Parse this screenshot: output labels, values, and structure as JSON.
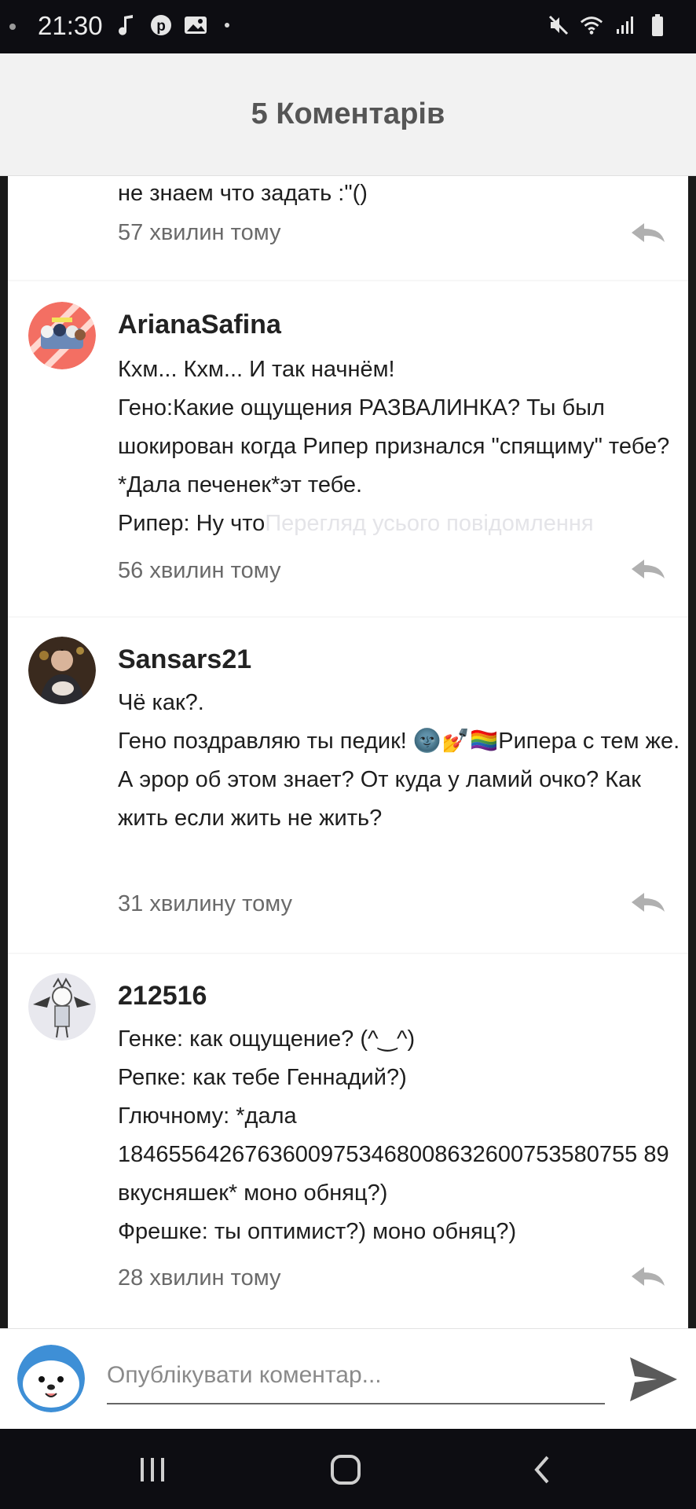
{
  "status_bar": {
    "time": "21:30",
    "left_icons": [
      "music-note-icon",
      "pinterest-icon",
      "gallery-icon"
    ],
    "right_icons": [
      "mute-icon",
      "wifi-icon",
      "signal-icon",
      "battery-icon"
    ]
  },
  "header": {
    "title": "5 Коментарів"
  },
  "comments": [
    {
      "author": "",
      "body": "не знаем что задать :\"()",
      "time": "57 хвилин тому"
    },
    {
      "author": "ArianaSafina",
      "body": "Кхм... Кхм... И так начнём!\nГено:Какие ощущения РАЗВАЛИНКА? Ты был шокирован когда Рипер признался \"спящиму\" тебе? *Дала печенек*эт тебе.\nРипер: Ну что",
      "more_link": "Перегляд усього повідомлення",
      "time": "56 хвилин тому"
    },
    {
      "author": "Sansars21",
      "body": "Чё как?.\nГено поздравляю ты педик! 🌚💅🏳️‍🌈Рипера с тем же.\nА эрор об этом знает? От куда у ламий очко? Как жить если жить не жить?",
      "time": "31 хвилину тому"
    },
    {
      "author": "212516",
      "body": "Генке: как ощущение? (^‿^)\nРепке: как тебе Геннадий?)\nГлючному: *дала 18465564267636009753468008632600753580755 89 вкусняшек* моно обняц?)\nФрешке: ты оптимист?) моно обняц?)",
      "time": "28 хвилин тому"
    }
  ],
  "composer": {
    "placeholder": "Опублікувати коментар..."
  },
  "colors": {
    "accent": "#555555",
    "time_text": "#6a6a6a",
    "reply_icon": "#b0b0b0"
  }
}
